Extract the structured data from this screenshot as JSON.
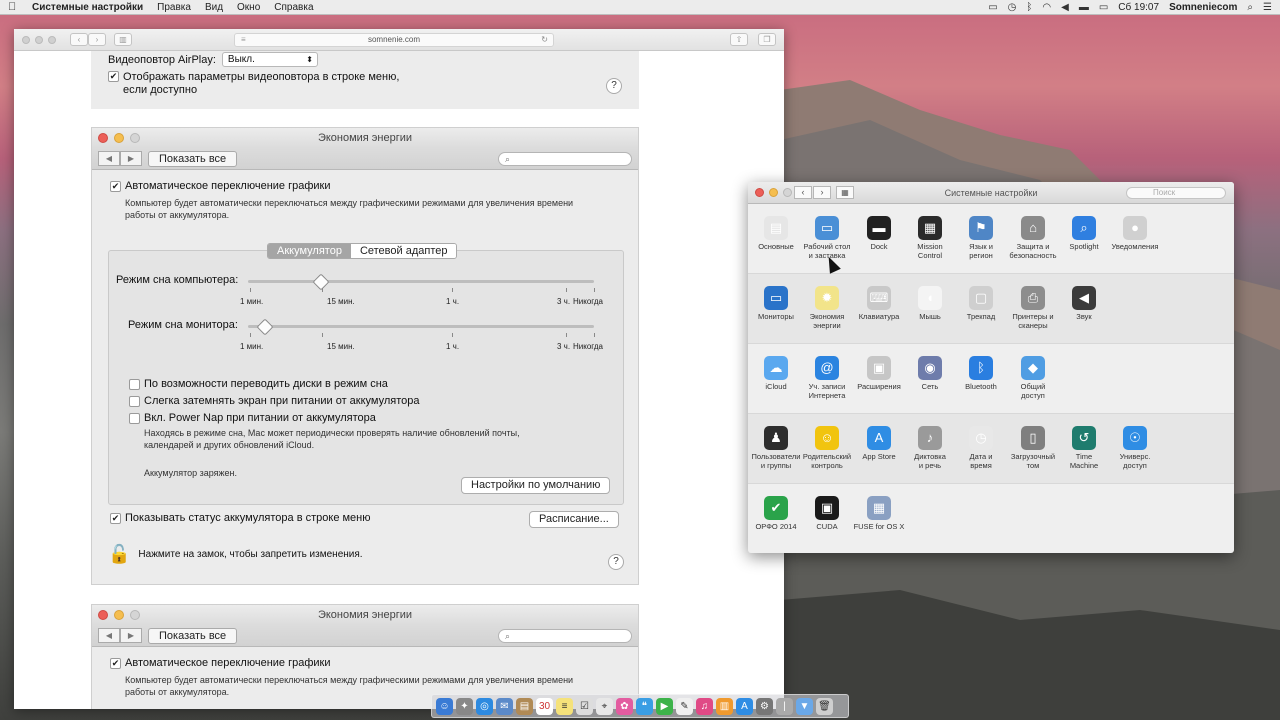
{
  "menubar": {
    "app": "Системные настройки",
    "items": [
      "Правка",
      "Вид",
      "Окно",
      "Справка"
    ],
    "clock": "Сб 19:07",
    "user": "Somneniecom"
  },
  "safari": {
    "url": "somnenie.com"
  },
  "airplay": {
    "label": "Видеоповтор AirPlay:",
    "value": "Выкл.",
    "show_in_menu": "Отображать параметры видеоповтора в строке меню,",
    "show_in_menu2": "если доступно",
    "help": "?"
  },
  "energy": {
    "title": "Экономия энергии",
    "show_all": "Показать все",
    "auto_graphics": "Автоматическое переключение графики",
    "auto_graphics_desc1": "Компьютер будет автоматически переключаться между графическими режимами для увеличения времени",
    "auto_graphics_desc2": "работы от аккумулятора.",
    "tab_battery": "Аккумулятор",
    "tab_adapter": "Сетевой адаптер",
    "sleep_computer": "Режим сна компьютера:",
    "sleep_display": "Режим сна монитора:",
    "ticks": [
      "1 мин.",
      "15 мин.",
      "1 ч.",
      "3 ч.",
      "Никогда"
    ],
    "computer_sleep_level": 0.21,
    "display_sleep_level": 0.05,
    "opt_disks": "По возможности переводить диски в режим сна",
    "opt_dim": "Слегка затемнять экран при питании от аккумулятора",
    "opt_powernap": "Вкл. Power Nap при питании от аккумулятора",
    "powernap_desc1": "Находясь в режиме сна, Mac может периодически проверять наличие обновлений почты,",
    "powernap_desc2": "календарей и других обновлений iCloud.",
    "battery_status": "Аккумулятор заряжен.",
    "defaults": "Настройки по умолчанию",
    "show_status": "Показывать статус аккумулятора в строке меню",
    "schedule": "Расписание...",
    "lock_text": "Нажмите на замок, чтобы запретить изменения.",
    "help": "?"
  },
  "syspref": {
    "title": "Системные настройки",
    "search_placeholder": "Поиск",
    "rows": [
      [
        {
          "l1": "Основные",
          "l2": "",
          "icon": "general-icon",
          "color": "#e6e6e6"
        },
        {
          "l1": "Рабочий стол",
          "l2": "и заставка",
          "icon": "desktop-icon",
          "color": "#4a8fd6"
        },
        {
          "l1": "Dock",
          "l2": "",
          "icon": "dock-icon",
          "color": "#222"
        },
        {
          "l1": "Mission",
          "l2": "Control",
          "icon": "mission-control-icon",
          "color": "#2b2b2b"
        },
        {
          "l1": "Язык и",
          "l2": "регион",
          "icon": "language-icon",
          "color": "#4f86c6"
        },
        {
          "l1": "Защита и",
          "l2": "безопасность",
          "icon": "security-icon",
          "color": "#8a8a8a"
        },
        {
          "l1": "Spotlight",
          "l2": "",
          "icon": "spotlight-icon",
          "color": "#2f7fe0"
        },
        {
          "l1": "Уведомления",
          "l2": "",
          "icon": "notifications-icon",
          "color": "#d0d0d0"
        }
      ],
      [
        {
          "l1": "Мониторы",
          "l2": "",
          "icon": "displays-icon",
          "color": "#2a73c9"
        },
        {
          "l1": "Экономия",
          "l2": "энергии",
          "icon": "energy-icon",
          "color": "#f2e48a"
        },
        {
          "l1": "Клавиатура",
          "l2": "",
          "icon": "keyboard-icon",
          "color": "#c9c9c9"
        },
        {
          "l1": "Мышь",
          "l2": "",
          "icon": "mouse-icon",
          "color": "#f4f4f4"
        },
        {
          "l1": "Трекпад",
          "l2": "",
          "icon": "trackpad-icon",
          "color": "#cfcfcf"
        },
        {
          "l1": "Принтеры и",
          "l2": "сканеры",
          "icon": "printer-icon",
          "color": "#8d8d8d"
        },
        {
          "l1": "Звук",
          "l2": "",
          "icon": "sound-icon",
          "color": "#3b3b3b"
        }
      ],
      [
        {
          "l1": "iCloud",
          "l2": "",
          "icon": "icloud-icon",
          "color": "#5aa8ef"
        },
        {
          "l1": "Уч. записи",
          "l2": "Интернета",
          "icon": "internet-accounts-icon",
          "color": "#2b84e0"
        },
        {
          "l1": "Расширения",
          "l2": "",
          "icon": "extensions-icon",
          "color": "#c6c6c6"
        },
        {
          "l1": "Сеть",
          "l2": "",
          "icon": "network-icon",
          "color": "#6e7cab"
        },
        {
          "l1": "Bluetooth",
          "l2": "",
          "icon": "bluetooth-icon",
          "color": "#2a7ee0"
        },
        {
          "l1": "Общий",
          "l2": "доступ",
          "icon": "sharing-icon",
          "color": "#4f9de3"
        }
      ],
      [
        {
          "l1": "Пользователи",
          "l2": "и группы",
          "icon": "users-icon",
          "color": "#2d2d2d"
        },
        {
          "l1": "Родительский",
          "l2": "контроль",
          "icon": "parental-icon",
          "color": "#f1c40f"
        },
        {
          "l1": "App Store",
          "l2": "",
          "icon": "appstore-icon",
          "color": "#2f8de4"
        },
        {
          "l1": "Диктовка",
          "l2": "и речь",
          "icon": "dictation-icon",
          "color": "#9a9a9a"
        },
        {
          "l1": "Дата и",
          "l2": "время",
          "icon": "date-time-icon",
          "color": "#e8e8e8"
        },
        {
          "l1": "Загрузочный",
          "l2": "том",
          "icon": "startup-disk-icon",
          "color": "#7f7f7f"
        },
        {
          "l1": "Time",
          "l2": "Machine",
          "icon": "time-machine-icon",
          "color": "#1f7c6e"
        },
        {
          "l1": "Универс.",
          "l2": "доступ",
          "icon": "accessibility-icon",
          "color": "#2f8de4"
        }
      ],
      [
        {
          "l1": "ОРФО 2014",
          "l2": "",
          "icon": "orfo-icon",
          "color": "#2aa34a"
        },
        {
          "l1": "CUDA",
          "l2": "",
          "icon": "cuda-icon",
          "color": "#1a1a1a"
        },
        {
          "l1": "FUSE for OS X",
          "l2": "",
          "icon": "fuse-icon",
          "color": "#8aa0c2"
        }
      ]
    ]
  }
}
